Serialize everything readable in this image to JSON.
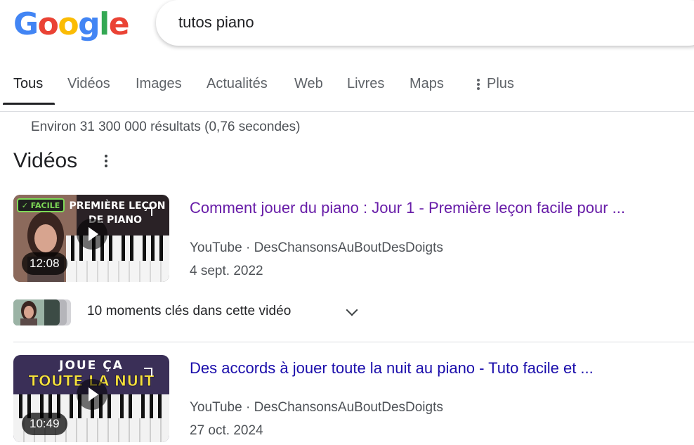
{
  "logo": {
    "letters": [
      {
        "char": "G",
        "color": "#4285f4"
      },
      {
        "char": "o",
        "color": "#ea4335"
      },
      {
        "char": "o",
        "color": "#fbbc05"
      },
      {
        "char": "g",
        "color": "#4285f4"
      },
      {
        "char": "l",
        "color": "#34a853"
      },
      {
        "char": "e",
        "color": "#ea4335"
      }
    ]
  },
  "search": {
    "query": "tutos piano"
  },
  "tabs": {
    "items": [
      "Tous",
      "Vidéos",
      "Images",
      "Actualités",
      "Web",
      "Livres",
      "Maps"
    ],
    "more": "Plus",
    "active": "Tous"
  },
  "stats": "Environ 31 300 000 résultats (0,76 secondes)",
  "section": {
    "title": "Vidéos"
  },
  "videos": [
    {
      "title": "Comment jouer du piano : Jour 1 - Première leçon facile pour ...",
      "source": "YouTube",
      "channel": "DesChansonsAuBoutDesDoigts",
      "separator": " · ",
      "date": "4 sept. 2022",
      "duration": "12:08",
      "thumb_badge": "✓ FACILE",
      "thumb_text_1": "PREMIÈRE LEÇON",
      "thumb_text_2": "DE PIANO",
      "visited": true
    },
    {
      "title": "Des accords à jouer toute la nuit au piano - Tuto facile et ...",
      "source": "YouTube",
      "channel": "DesChansonsAuBoutDesDoigts",
      "separator": " · ",
      "date": "27 oct. 2024",
      "duration": "10:49",
      "thumb_text_1": "JOUE ÇA",
      "thumb_text_2": "TOUTE LA NUIT",
      "visited": false
    }
  ],
  "moments": {
    "label": "10 moments clés dans cette vidéo"
  }
}
